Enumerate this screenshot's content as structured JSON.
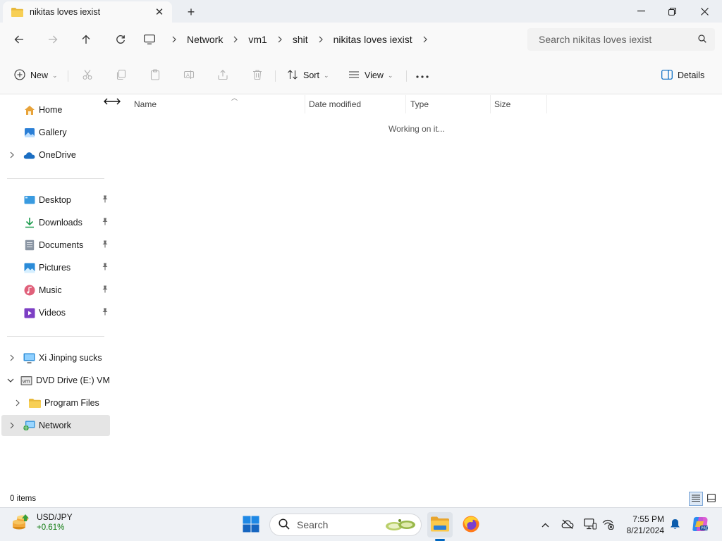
{
  "window": {
    "tab_title": "nikitas loves iexist",
    "close_tab_glyph": "✕",
    "new_tab_glyph": "+",
    "controls": {
      "minimize_glyph": "—",
      "maximize_glyph": "❐",
      "close_glyph": "✕"
    }
  },
  "address": {
    "breadcrumbs": [
      "Network",
      "vm1",
      "shit",
      "nikitas loves iexist"
    ],
    "search_placeholder": "Search nikitas loves iexist"
  },
  "commandbar": {
    "new_label": "New",
    "sort_label": "Sort",
    "view_label": "View",
    "more_glyph": "•••",
    "details_label": "Details"
  },
  "nav": {
    "quick": [
      {
        "label": "Home",
        "icon": "home-icon"
      },
      {
        "label": "Gallery",
        "icon": "gallery-icon"
      },
      {
        "label": "OneDrive",
        "icon": "onedrive-icon"
      }
    ],
    "pinned": [
      {
        "label": "Desktop",
        "icon": "desktop-icon"
      },
      {
        "label": "Downloads",
        "icon": "downloads-icon"
      },
      {
        "label": "Documents",
        "icon": "documents-icon"
      },
      {
        "label": "Pictures",
        "icon": "pictures-icon"
      },
      {
        "label": "Music",
        "icon": "music-icon"
      },
      {
        "label": "Videos",
        "icon": "videos-icon"
      }
    ],
    "devices": [
      {
        "label": "Xi Jinping sucks",
        "icon": "computer-icon"
      },
      {
        "label": "DVD Drive (E:) VMw",
        "icon": "dvd-drive-icon"
      },
      {
        "label": "Program Files",
        "icon": "folder-icon"
      },
      {
        "label": "Network",
        "icon": "network-icon"
      }
    ]
  },
  "content": {
    "columns": [
      "Name",
      "Date modified",
      "Type",
      "Size"
    ],
    "status_message": "Working on it..."
  },
  "statusbar": {
    "item_count": "0 items"
  },
  "taskbar": {
    "widget": {
      "ticker": "USD/JPY",
      "change": "+0.61%"
    },
    "search_label": "Search",
    "clock": {
      "time": "7:55 PM",
      "date": "8/21/2024"
    }
  },
  "colors": {
    "accent": "#0067c0",
    "selected_bg": "#e5e5e5",
    "chrome_bg": "#f9f9f9",
    "tab_strip_bg": "#eceff3",
    "positive": "#0f7b0f"
  }
}
